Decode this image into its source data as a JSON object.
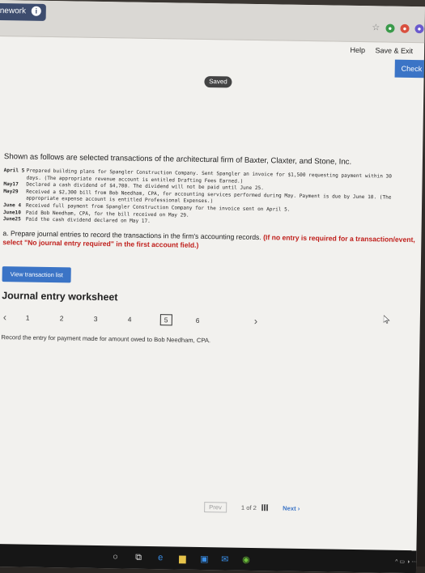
{
  "app": {
    "homework_tab": "nework",
    "saved_status": "Saved",
    "help_label": "Help",
    "save_exit_label": "Save & Exit",
    "check_label": "Check n"
  },
  "intro": "Shown as follows are selected transactions of the architectural firm of Baxter, Claxter, and Stone, Inc.",
  "transactions": [
    {
      "date": "April 5",
      "line1": "Prepared building plans for Spangler Construction Company. Sent Spangler an invoice for $1,500 requesting payment within 30",
      "line2": "days. (The appropriate revenue account is entitled Drafting Fees Earned.)"
    },
    {
      "date": "May17",
      "line1": "Declared a cash dividend of $4,700. The dividend will not be paid until June 25.",
      "line2": ""
    },
    {
      "date": "May29",
      "line1": "Received a $2,300 bill from Bob Needham, CPA, for accounting services performed during May. Payment is due by June 10. (The",
      "line2": "appropriate expense account is entitled Professional Expenses.)"
    },
    {
      "date": "June 4",
      "line1": "Received full payment from Spangler Construction Company for the invoice sent on April 5.",
      "line2": ""
    },
    {
      "date": "June10",
      "line1": "Paid Bob Needham, CPA, for the bill received on May 29.",
      "line2": ""
    },
    {
      "date": "June25",
      "line1": "Paid the cash dividend declared on May 17.",
      "line2": ""
    }
  ],
  "instruction": {
    "text": "a. Prepare journal entries to record the transactions in the firm's accounting records.",
    "red": "(If no entry is required for a transaction/event, select \"No journal entry required\" in the first account field.)"
  },
  "view_transaction_button": "View transaction list",
  "worksheet": {
    "title": "Journal entry worksheet",
    "pages": [
      "1",
      "2",
      "3",
      "4",
      "5",
      "6"
    ],
    "active_page": "5",
    "description": "Record the entry for payment made for amount owed to Bob Needham, CPA."
  },
  "bottom_nav": {
    "prev": "Prev",
    "count": "1 of 2",
    "next": "Next"
  },
  "icons": {
    "info": "info-icon",
    "prev_arrow": "chevron-left-icon",
    "next_arrow": "chevron-right-icon"
  },
  "colors": {
    "accent": "#3b74c6",
    "instruction_red": "#c0201c",
    "tab": "#3d4c6e"
  }
}
